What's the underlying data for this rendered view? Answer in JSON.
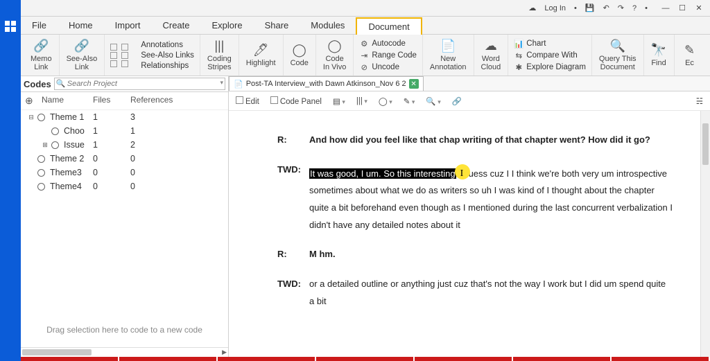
{
  "titlebar": {
    "login": "Log In",
    "sep": "•"
  },
  "menu": {
    "file": "File",
    "home": "Home",
    "import": "Import",
    "create": "Create",
    "explore": "Explore",
    "share": "Share",
    "modules": "Modules",
    "document": "Document"
  },
  "ribbon": {
    "memo_link": "Memo\nLink",
    "seealso_link": "See-Also\nLink",
    "annotations": "Annotations",
    "seealso_links": "See-Also Links",
    "relationships": "Relationships",
    "coding_stripes": "Coding\nStripes",
    "highlight": "Highlight",
    "code": "Code",
    "code_in_vivo": "Code\nIn Vivo",
    "autocode": "Autocode",
    "range_code": "Range Code",
    "uncode": "Uncode",
    "new_annotation": "New\nAnnotation",
    "word_cloud": "Word\nCloud",
    "chart": "Chart",
    "compare_with": "Compare With",
    "explore_diagram": "Explore Diagram",
    "query_this": "Query This\nDocument",
    "find": "Find",
    "edit_cut": "Ec"
  },
  "sidebar": {
    "title": "Codes",
    "search_placeholder": "Search Project",
    "cols": {
      "name": "Name",
      "files": "Files",
      "refs": "References"
    },
    "rows": [
      {
        "expander": "⊟",
        "name": "Theme 1",
        "files": "1",
        "refs": "3",
        "child": false
      },
      {
        "expander": "",
        "name": "Choo",
        "files": "1",
        "refs": "1",
        "child": true
      },
      {
        "expander": "⊞",
        "name": "Issue",
        "files": "1",
        "refs": "2",
        "child": true
      },
      {
        "expander": "",
        "name": "Theme 2",
        "files": "0",
        "refs": "0",
        "child": false
      },
      {
        "expander": "",
        "name": "Theme3",
        "files": "0",
        "refs": "0",
        "child": false
      },
      {
        "expander": "",
        "name": "Theme4",
        "files": "0",
        "refs": "0",
        "child": false
      }
    ],
    "hint": "Drag selection here to code to a new code"
  },
  "doc": {
    "tab_label": "Post-TA Interview_with Dawn Atkinson_Nov 6 2",
    "tools": {
      "edit": "Edit",
      "code_panel": "Code Panel"
    },
    "entries": [
      {
        "spk": "R:",
        "text_a": "And how did you feel like that chap writing of that chapter went?  How did it go?",
        "bold": true
      },
      {
        "spk": "TWD:",
        "hl": "It was good, I um.  So this interesting",
        "mid": "uess",
        "rest": " cuz I I think we're both very um introspective sometimes about what we do as writers so uh I was kind of I thought about the chapter quite a bit beforehand even though as I mentioned during the last concurrent verbalization I didn't have any detailed notes about it"
      },
      {
        "spk": "R:",
        "text_a": "M hm.",
        "bold": true
      },
      {
        "spk": "TWD:",
        "text_a": "or a detailed outline or anything just cuz that's not the way I work but I did um spend quite a bit"
      }
    ]
  }
}
